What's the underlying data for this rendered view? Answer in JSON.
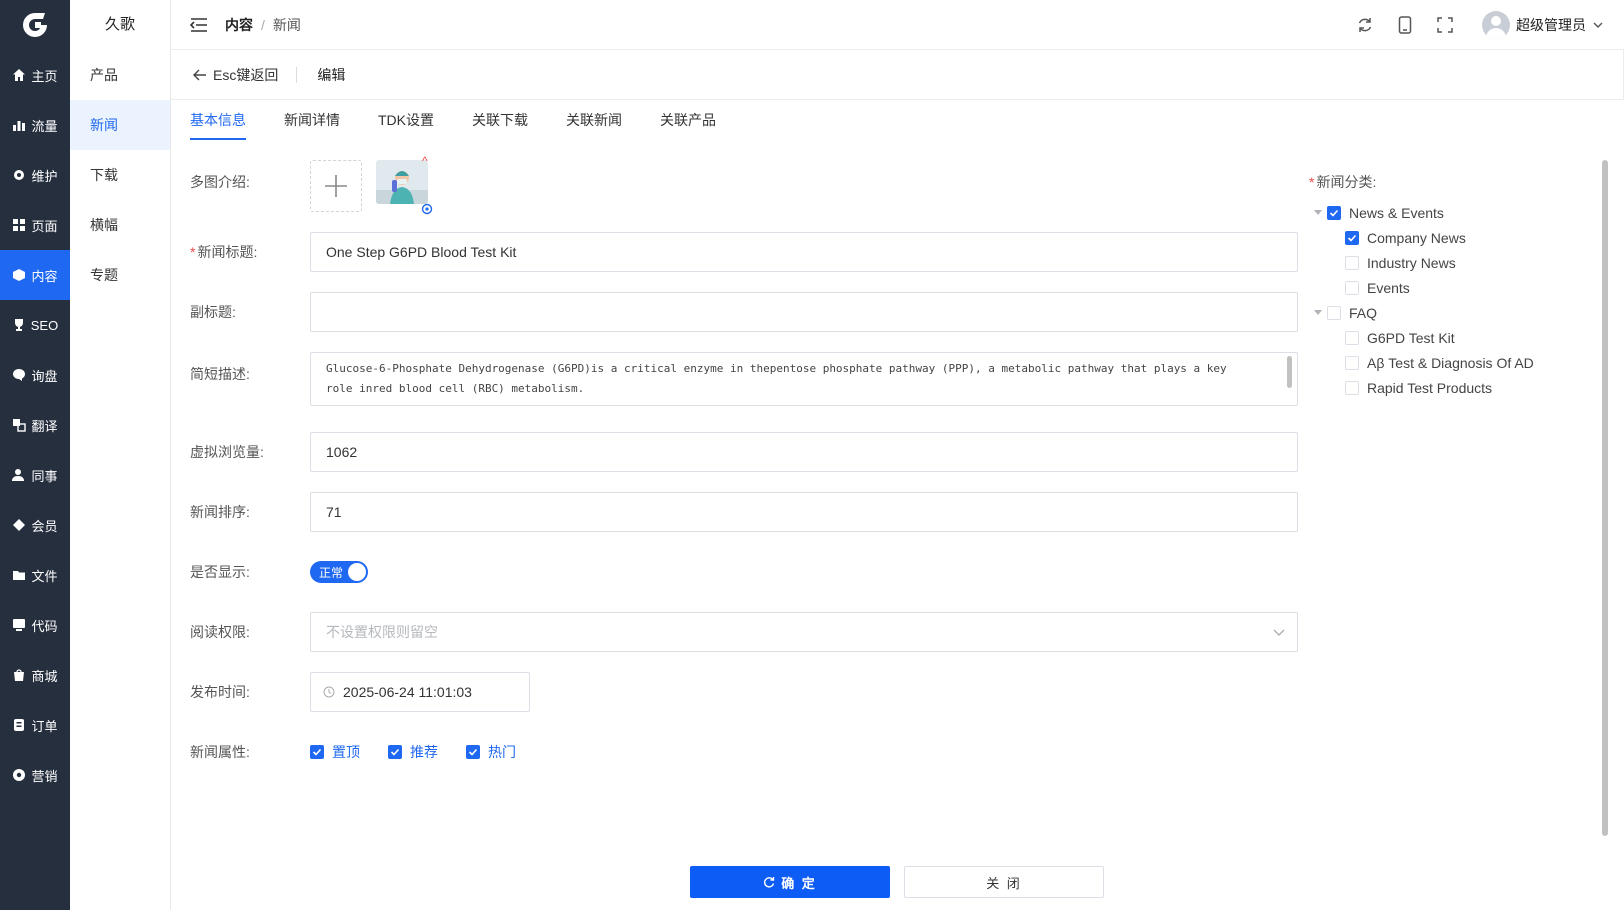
{
  "nav1": {
    "items": [
      {
        "label": "主页",
        "icon": "home-icon"
      },
      {
        "label": "流量",
        "icon": "bar-chart-icon"
      },
      {
        "label": "维护",
        "icon": "gear-icon"
      },
      {
        "label": "页面",
        "icon": "grid-icon"
      },
      {
        "label": "内容",
        "icon": "cube-icon",
        "active": true
      },
      {
        "label": "SEO",
        "icon": "trophy-icon"
      },
      {
        "label": "询盘",
        "icon": "chat-icon"
      },
      {
        "label": "翻译",
        "icon": "translate-icon"
      },
      {
        "label": "同事",
        "icon": "user-icon"
      },
      {
        "label": "会员",
        "icon": "diamond-icon"
      },
      {
        "label": "文件",
        "icon": "folder-icon"
      },
      {
        "label": "代码",
        "icon": "code-icon"
      },
      {
        "label": "商城",
        "icon": "shopping-bag-icon"
      },
      {
        "label": "订单",
        "icon": "order-icon"
      },
      {
        "label": "营销",
        "icon": "marketing-icon"
      }
    ]
  },
  "nav2": {
    "title": "久歌",
    "items": [
      "产品",
      "新闻",
      "下载",
      "横幅",
      "专题"
    ]
  },
  "header": {
    "crumb_parent": "内容",
    "crumb_sep": "/",
    "crumb_current": "新闻",
    "user_name": "超级管理员"
  },
  "backbar": {
    "back_label": "Esc键返回",
    "edit_label": "编辑"
  },
  "tabs": [
    "基本信息",
    "新闻详情",
    "TDK设置",
    "关联下载",
    "关联新闻",
    "关联产品"
  ],
  "form": {
    "images_label": "多图介绍:",
    "title_label": "新闻标题:",
    "title_value": "One Step G6PD Blood Test Kit",
    "subtitle_label": "副标题:",
    "subtitle_value": "",
    "desc_label": "简短描述:",
    "desc_value": "Glucose-6-Phosphate Dehydrogenase (G6PD)is a critical enzyme in thepentose phosphate pathway (PPP), a metabolic pathway that plays a key role inred blood cell (RBC) metabolism.",
    "views_label": "虚拟浏览量:",
    "views_value": "1062",
    "sort_label": "新闻排序:",
    "sort_value": "71",
    "show_label": "是否显示:",
    "show_value": "正常",
    "perm_label": "阅读权限:",
    "perm_placeholder": "不设置权限则留空",
    "time_label": "发布时间:",
    "time_value": "2025-06-24 11:01:03",
    "attr_label": "新闻属性:",
    "attrs": [
      "置顶",
      "推荐",
      "热门"
    ]
  },
  "category": {
    "label": "新闻分类:",
    "tree": [
      {
        "label": "News & Events",
        "checked": true,
        "children": [
          {
            "label": "Company News",
            "checked": true
          },
          {
            "label": "Industry News",
            "checked": false
          },
          {
            "label": "Events",
            "checked": false
          }
        ]
      },
      {
        "label": "FAQ",
        "checked": false,
        "children": [
          {
            "label": "G6PD Test Kit",
            "checked": false
          },
          {
            "label": "Aβ Test & Diagnosis Of AD",
            "checked": false
          },
          {
            "label": "Rapid Test Products",
            "checked": false
          }
        ]
      }
    ]
  },
  "buttons": {
    "ok": "确 定",
    "close": "关 闭"
  },
  "colors": {
    "primary": "#1f68f2",
    "sidebar": "#262f3e",
    "required": "#f04848"
  }
}
